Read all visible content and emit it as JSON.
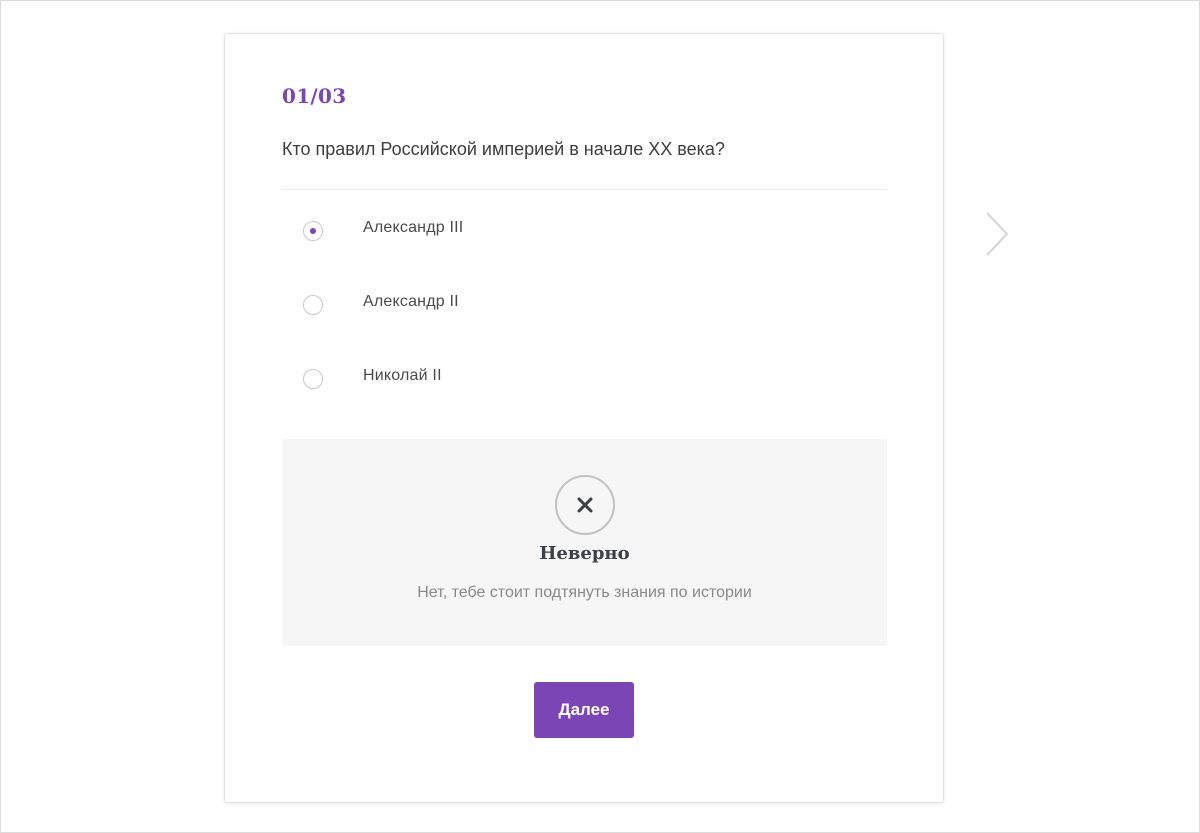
{
  "quiz": {
    "counter": "01/03",
    "question": "Кто правил Российской империей в начале XX века?",
    "options": [
      {
        "label": "Александр III",
        "selected": true
      },
      {
        "label": "Александр II",
        "selected": false
      },
      {
        "label": "Николай II",
        "selected": false
      }
    ]
  },
  "feedback": {
    "icon": "close-icon",
    "title": "Неверно",
    "text": "Нет, тебе стоит подтянуть знания по истории"
  },
  "actions": {
    "next_label": "Далее",
    "next_arrow_icon": "chevron-right-icon"
  },
  "colors": {
    "accent": "#7b45b6",
    "feedback_bg": "#f6f6f6",
    "text": "#3d3d3d"
  }
}
